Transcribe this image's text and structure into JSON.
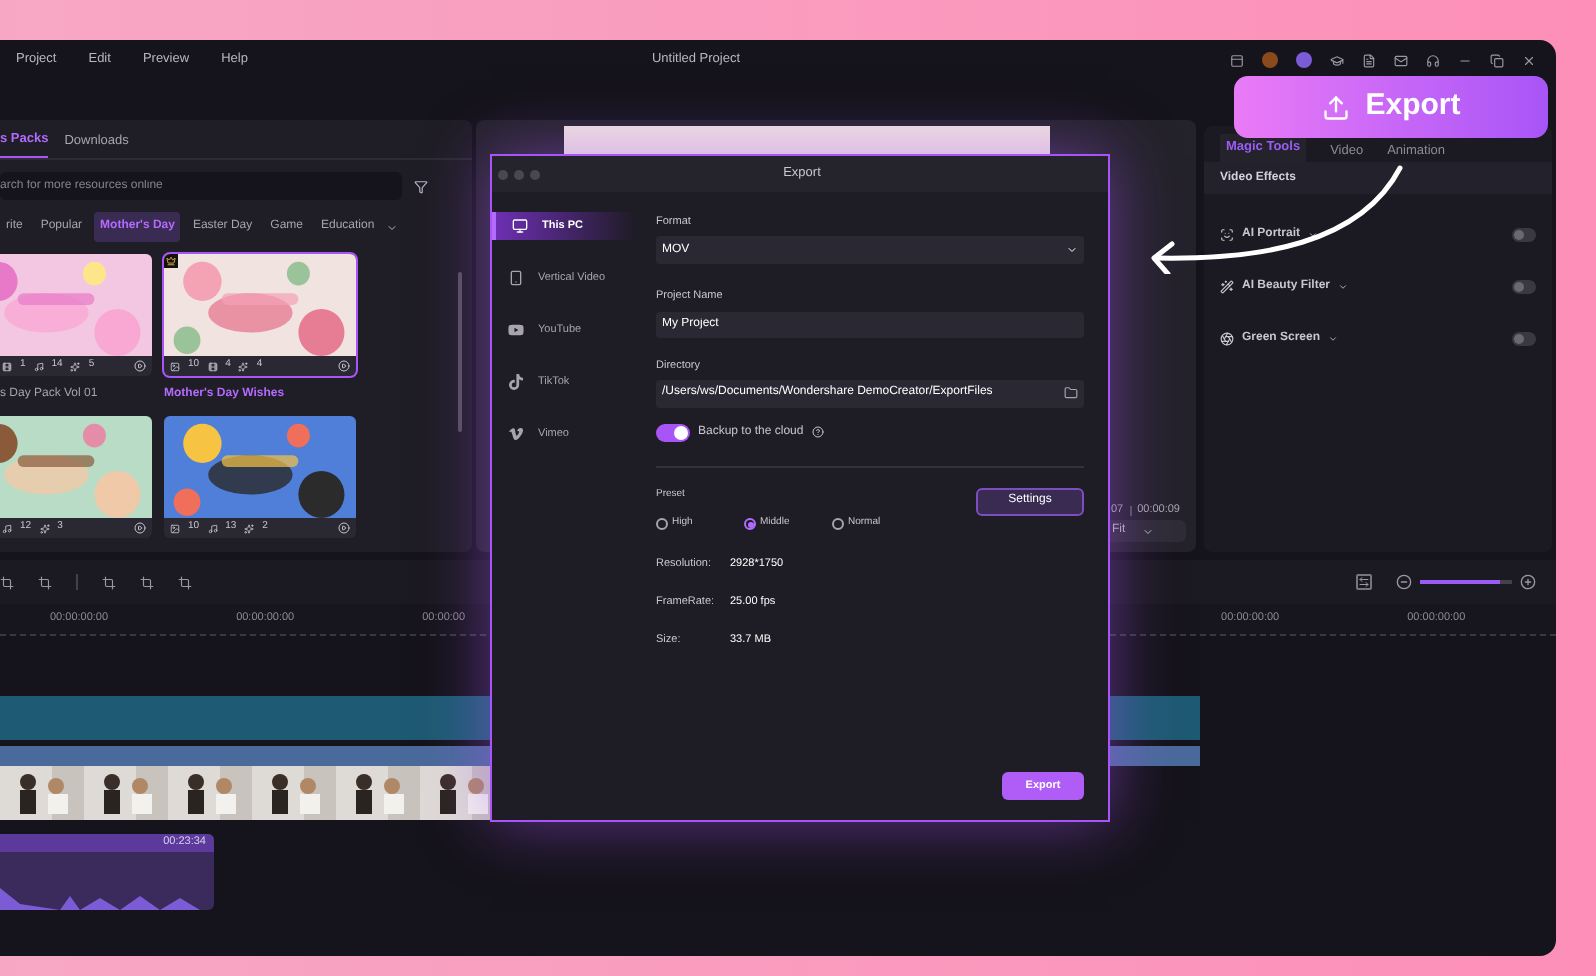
{
  "titlebar": {
    "menu": [
      "Project",
      "Edit",
      "Preview",
      "Help"
    ],
    "title": "Untitled Project"
  },
  "library": {
    "tabs": [
      {
        "label": "s Packs",
        "selected": true
      },
      {
        "label": "Downloads",
        "selected": false
      }
    ],
    "search": {
      "placeholder": "arch for more resources online"
    },
    "categories": [
      {
        "label": "rite",
        "selected": false
      },
      {
        "label": "Popular",
        "selected": false
      },
      {
        "label": "Mother's Day",
        "selected": true
      },
      {
        "label": "Easter Day",
        "selected": false
      },
      {
        "label": "Game",
        "selected": false
      },
      {
        "label": "Education",
        "selected": false
      }
    ],
    "cards": [
      {
        "kind": "picture",
        "premium": false,
        "selected": false,
        "title": "s Day Pack Vol 01",
        "stats": [
          {
            "kind": "clip",
            "value": "1"
          },
          {
            "kind": "audio",
            "value": "14"
          },
          {
            "kind": "effect",
            "value": "5"
          }
        ]
      },
      {
        "kind": "picture",
        "premium": true,
        "selected": true,
        "title": "Mother's Day Wishes",
        "stats": [
          {
            "kind": "media",
            "value": "10"
          },
          {
            "kind": "clip",
            "value": "4"
          },
          {
            "kind": "effect",
            "value": "4"
          }
        ]
      },
      {
        "kind": "picture",
        "premium": false,
        "selected": false,
        "stats": [
          {
            "kind": "audio",
            "value": "12"
          },
          {
            "kind": "effect",
            "value": "3"
          }
        ]
      },
      {
        "kind": "picture",
        "premium": false,
        "selected": false,
        "stats": [
          {
            "kind": "media",
            "value": "10"
          },
          {
            "kind": "audio",
            "value": "13"
          },
          {
            "kind": "effect",
            "value": "2"
          }
        ]
      }
    ]
  },
  "preview": {
    "time_current": "07",
    "time_total": "00:00:09",
    "fit": "Fit"
  },
  "properties": {
    "tabs": [
      {
        "label": "Magic Tools",
        "selected": true
      },
      {
        "label": "Video",
        "selected": false
      },
      {
        "label": "Animation",
        "selected": false
      }
    ],
    "section": "Video Effects",
    "effects": [
      {
        "kind": "portrait",
        "label": "AI Portrait",
        "on": false
      },
      {
        "kind": "beauty",
        "label": "AI Beauty Filter",
        "on": false
      },
      {
        "kind": "green",
        "label": "Green Screen",
        "on": false
      }
    ]
  },
  "timeline": {
    "ruler": [
      "00:00:00:00",
      "00:00:00:00",
      "00:00:00",
      "00:00:00:00",
      "00:00:00:00"
    ],
    "zoom": {
      "level": 0.88
    },
    "audio_clip": {
      "duration": "00:23:34"
    }
  },
  "export_dialog": {
    "title": "Export",
    "destinations": [
      {
        "kind": "pc",
        "label": "This PC",
        "selected": true
      },
      {
        "kind": "vertical",
        "label": "Vertical Video",
        "selected": false
      },
      {
        "kind": "youtube",
        "label": "YouTube",
        "selected": false
      },
      {
        "kind": "tiktok",
        "label": "TikTok",
        "selected": false
      },
      {
        "kind": "vimeo",
        "label": "Vimeo",
        "selected": false
      }
    ],
    "format": {
      "label": "Format",
      "value": "MOV"
    },
    "project_name": {
      "label": "Project Name",
      "value": "My Project"
    },
    "directory": {
      "label": "Directory",
      "value": "/Users/ws/Documents/Wondershare DemoCreator/ExportFiles"
    },
    "backup": {
      "label": "Backup to the cloud",
      "on": true
    },
    "preset": {
      "label": "Preset",
      "options": [
        {
          "label": "High",
          "selected": false
        },
        {
          "label": "Middle",
          "selected": true
        },
        {
          "label": "Normal",
          "selected": false
        }
      ]
    },
    "settings_button": "Settings",
    "info": [
      {
        "label": "Resolution:",
        "value": "2928*1750"
      },
      {
        "label": "FrameRate:",
        "value": "25.00 fps"
      },
      {
        "label": "Size:",
        "value": "33.7 MB"
      }
    ],
    "export_button": "Export"
  },
  "callout": {
    "label": "Export"
  }
}
